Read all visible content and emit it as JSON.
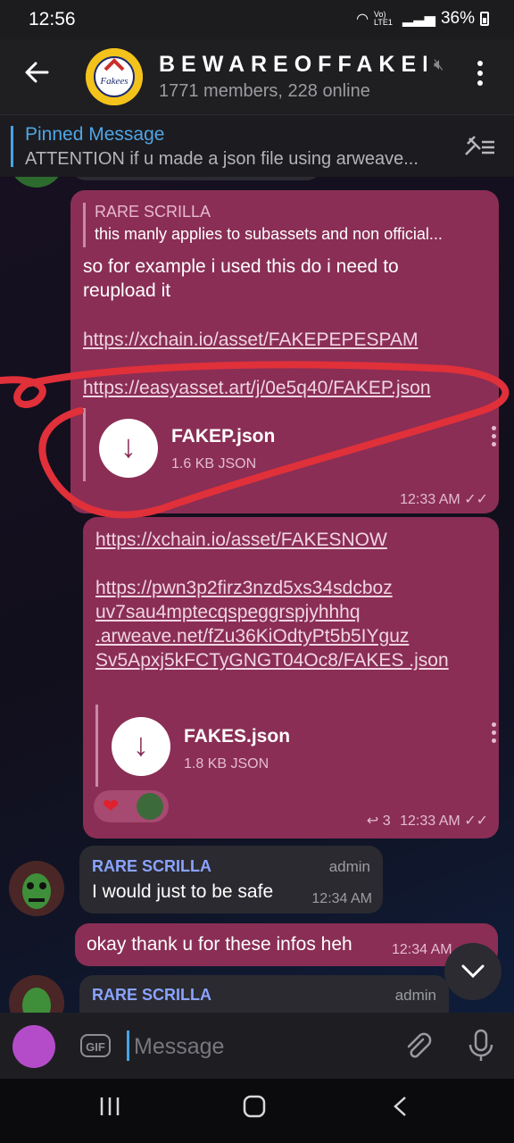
{
  "status_bar": {
    "time": "12:56",
    "network": "Vo) LTE1",
    "battery": "36%"
  },
  "header": {
    "title": "BEWAREOFFAKER",
    "subtitle": "1771 members, 228 online"
  },
  "pinned": {
    "label": "Pinned Message",
    "text": "ATTENTION if u made a json file using arweave..."
  },
  "messages": [
    {
      "reply_to_name": "RARE SCRILLA",
      "reply_to_text": "this manly applies to subassets and non official...",
      "text": "so for example i used this do i need to reupload it",
      "link1": "https://xchain.io/asset/FAKEPEPESPAM",
      "link2": "https://easyasset.art/j/0e5q40/FAKEP.json",
      "file_name": "FAKEP.json",
      "file_size": "1.6 KB JSON",
      "time": "12:33 AM"
    },
    {
      "link1": "https://xchain.io/asset/FAKESNOW",
      "link2": "https://pwn3p2firz3nzd5xs34sdcboz uv7sau4mptecqspeggrspjyhhhq .arweave.net/fZu36KiOdtyPt5b5IYguz Sv5Apxj5kFCTyGNGT04Oc8/FAKES .json",
      "file_name": "FAKES.json",
      "file_size": "1.8 KB JSON",
      "replies": "3",
      "time": "12:33 AM"
    },
    {
      "sender": "RARE SCRILLA",
      "role": "admin",
      "text": "I would just to be safe",
      "time": "12:34 AM"
    },
    {
      "text": "okay thank u for these infos heh",
      "time": "12:34 AM"
    },
    {
      "sender": "RARE SCRILLA",
      "role": "admin"
    }
  ],
  "input": {
    "placeholder": "Message",
    "gif_label": "GIF"
  },
  "colors": {
    "outgoing_bubble": "#8a2e55",
    "incoming_bubble": "#2a2a30",
    "accent": "#47a4e6",
    "annotation": "#e0303a"
  }
}
